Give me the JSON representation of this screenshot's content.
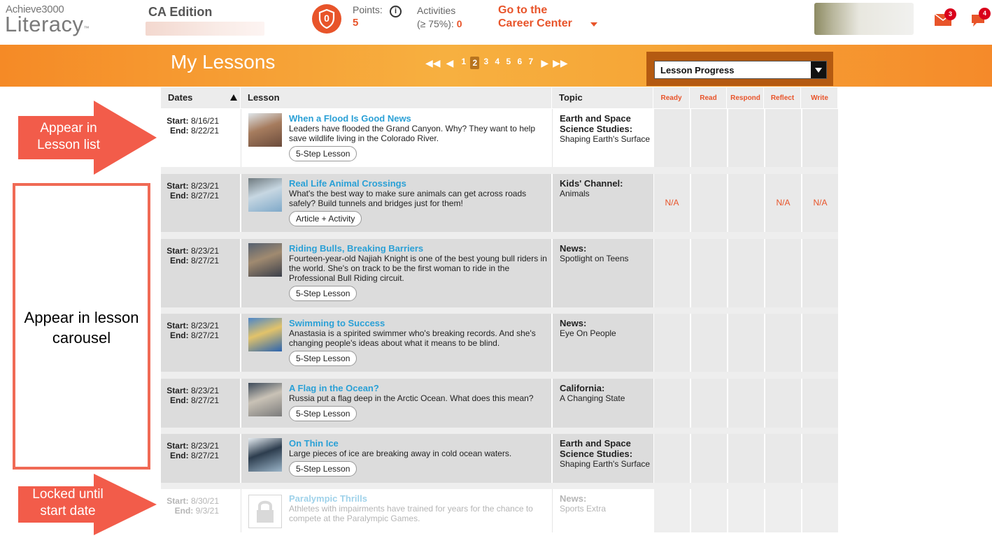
{
  "header": {
    "logo_top": "Achieve3000",
    "logo_main": "Literacy",
    "logo_tm": "™",
    "edition": "CA Edition",
    "points_label": "Points:",
    "points_value": "5",
    "info_glyph": "i",
    "shield_value": "0",
    "activities_label_1": "Activities",
    "activities_label_2": "(≥ 75%):",
    "activities_value": "0",
    "career_line1": "Go to the",
    "career_line2": "Career Center",
    "mail_badge": "3",
    "chat_badge": "4",
    "accent_color": "#e8542a"
  },
  "band": {
    "title": "My Lessons",
    "pages": [
      "1",
      "2",
      "3",
      "4",
      "5",
      "6",
      "7"
    ],
    "current_page": "2",
    "select_value": "Lesson Progress"
  },
  "table": {
    "headers": {
      "dates": "Dates",
      "lesson": "Lesson",
      "topic": "Topic"
    },
    "progress_headers": [
      "Ready",
      "Read",
      "Respond",
      "Reflect",
      "Write"
    ],
    "start_label": "Start:",
    "end_label": "End:",
    "rows": [
      {
        "start": "8/16/21",
        "end": "8/22/21",
        "title": "When a Flood Is Good News",
        "desc": "Leaders have flooded the Grand Canyon. Why? They want to help save wildlife living in the Colorado River.",
        "button": "5-Step Lesson",
        "topic_bold": "Earth and Space Science Studies:",
        "topic_sub": "Shaping Earth's Surface",
        "progress": [
          "",
          "",
          "",
          "",
          ""
        ]
      },
      {
        "start": "8/23/21",
        "end": "8/27/21",
        "title": "Real Life Animal Crossings",
        "desc": "What's the best way to make sure animals can get across roads safely? Build tunnels and bridges just for them!",
        "button": "Article + Activity",
        "topic_bold": "Kids' Channel:",
        "topic_sub": "Animals",
        "progress": [
          "N/A",
          "",
          "",
          "N/A",
          "N/A"
        ]
      },
      {
        "start": "8/23/21",
        "end": "8/27/21",
        "title": "Riding Bulls, Breaking Barriers",
        "desc": "Fourteen-year-old Najiah Knight is one of the best young bull riders in the world. She's on track to be the first woman to ride in the Professional Bull Riding circuit.",
        "button": "5-Step Lesson",
        "topic_bold": "News:",
        "topic_sub": "Spotlight on Teens",
        "progress": [
          "",
          "",
          "",
          "",
          ""
        ]
      },
      {
        "start": "8/23/21",
        "end": "8/27/21",
        "title": "Swimming to Success",
        "desc": "Anastasia is a spirited swimmer who's breaking records. And she's changing people's ideas about what it means to be blind.",
        "button": "5-Step Lesson",
        "topic_bold": "News:",
        "topic_sub": "Eye On People",
        "progress": [
          "",
          "",
          "",
          "",
          ""
        ]
      },
      {
        "start": "8/23/21",
        "end": "8/27/21",
        "title": "A Flag in the Ocean?",
        "desc": "Russia put a flag deep in the Arctic Ocean. What does this mean?",
        "button": "5-Step Lesson",
        "topic_bold": "California:",
        "topic_sub": "A Changing State",
        "progress": [
          "",
          "",
          "",
          "",
          ""
        ]
      },
      {
        "start": "8/23/21",
        "end": "8/27/21",
        "title": "On Thin Ice",
        "desc": "Large pieces of ice are breaking away in cold ocean waters.",
        "button": "5-Step Lesson",
        "topic_bold": "Earth and Space Science Studies:",
        "topic_sub": "Shaping Earth's Surface",
        "progress": [
          "",
          "",
          "",
          "",
          ""
        ]
      },
      {
        "start": "8/30/21",
        "end": "9/3/21",
        "title": "Paralympic Thrills",
        "desc": "Athletes with impairments have trained for years for the chance to compete at the Paralympic Games.",
        "button": "",
        "topic_bold": "News:",
        "topic_sub": "Sports Extra",
        "progress": [
          "",
          "",
          "",
          "",
          ""
        ]
      }
    ]
  },
  "annotations": {
    "lesson_list": "Appear in Lesson list",
    "carousel": "Appear in lesson carousel",
    "locked": "Locked until start date",
    "color": "#f25c4a"
  }
}
